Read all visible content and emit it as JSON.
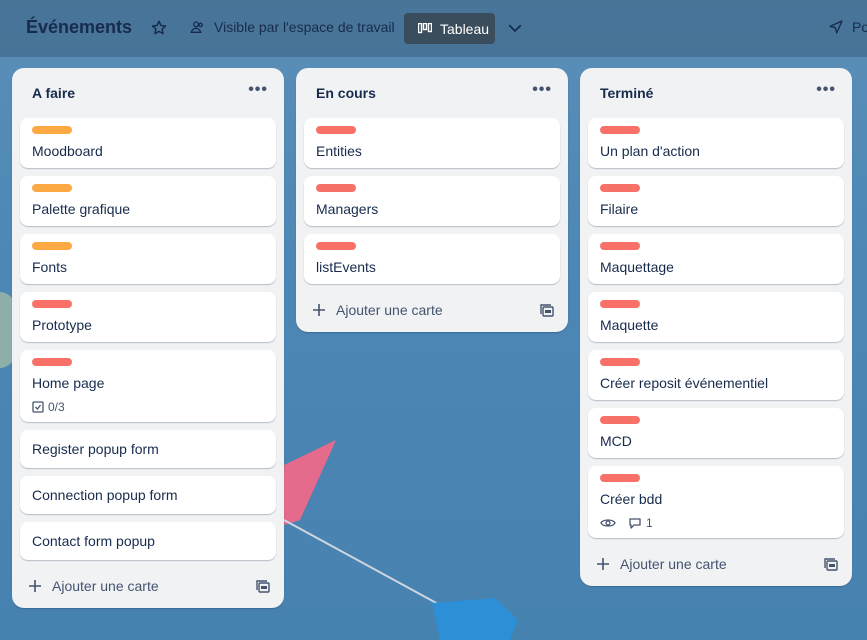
{
  "colors": {
    "orange": "#fca943",
    "red": "#f87168"
  },
  "header": {
    "title": "Événements",
    "star_icon": "star-icon",
    "visibility_label": "Visible par l'espace de travail",
    "view_label": "Tableau",
    "share_label": "Po"
  },
  "lists": [
    {
      "title": "A faire",
      "add_label": "Ajouter une carte",
      "cards": [
        {
          "label": "orange",
          "title": "Moodboard"
        },
        {
          "label": "orange",
          "title": "Palette grafique"
        },
        {
          "label": "orange",
          "title": "Fonts"
        },
        {
          "label": "red",
          "title": "Prototype"
        },
        {
          "label": "red",
          "title": "Home page",
          "checklist": "0/3"
        },
        {
          "title": "Register popup form"
        },
        {
          "title": "Connection popup form"
        },
        {
          "title": "Contact form popup"
        }
      ]
    },
    {
      "title": "En cours",
      "add_label": "Ajouter une carte",
      "cards": [
        {
          "label": "red",
          "title": "Entities"
        },
        {
          "label": "red",
          "title": "Managers"
        },
        {
          "label": "red",
          "title": "listEvents"
        }
      ]
    },
    {
      "title": "Terminé",
      "add_label": "Ajouter une carte",
      "cards": [
        {
          "label": "red",
          "title": "Un plan d'action"
        },
        {
          "label": "red",
          "title": "Filaire"
        },
        {
          "label": "red",
          "title": "Maquettage"
        },
        {
          "label": "red",
          "title": "Maquette"
        },
        {
          "label": "red",
          "title": "Créer reposit événementiel"
        },
        {
          "label": "red",
          "title": "MCD"
        },
        {
          "label": "red",
          "title": "Créer bdd",
          "watching": true,
          "comments": "1"
        }
      ]
    }
  ]
}
